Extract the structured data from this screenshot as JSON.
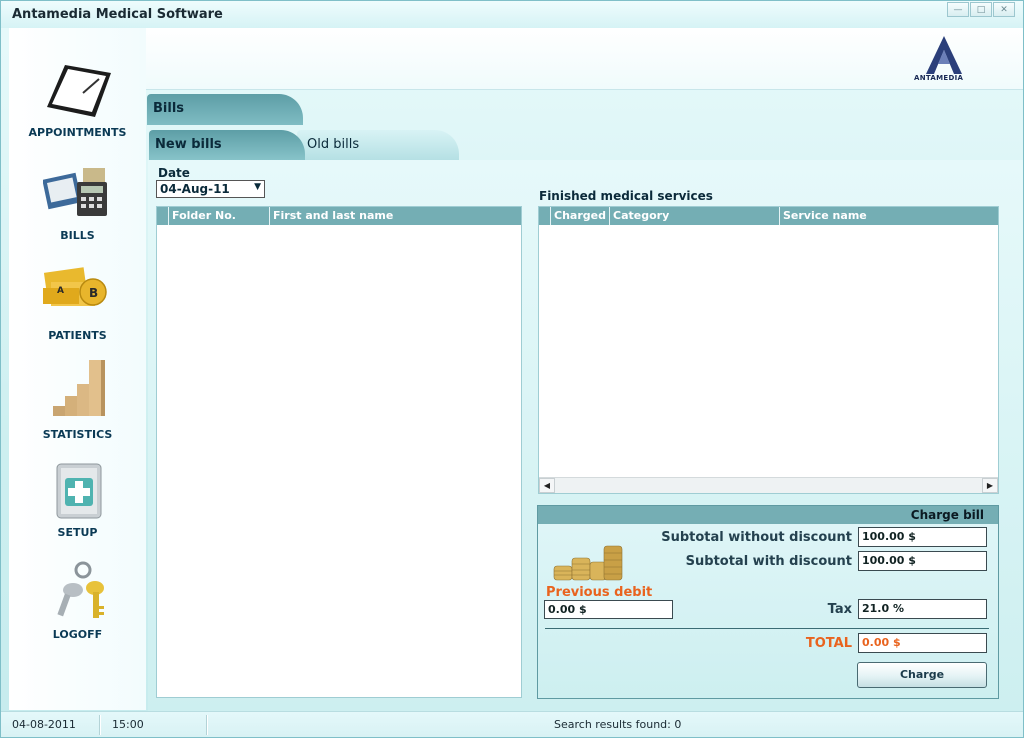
{
  "app": {
    "title": "Antamedia Medical Software",
    "logo_text": "ANTAMEDIA"
  },
  "window_controls": [
    "minimize",
    "maximize",
    "close"
  ],
  "sidebar": {
    "items": [
      {
        "label": "APPOINTMENTS",
        "icon": "clipboard-icon"
      },
      {
        "label": "BILLS",
        "icon": "calculator-icon"
      },
      {
        "label": "PATIENTS",
        "icon": "folders-icon"
      },
      {
        "label": "STATISTICS",
        "icon": "bar-chart-icon"
      },
      {
        "label": "SETUP",
        "icon": "medical-kit-icon"
      },
      {
        "label": "LOGOFF",
        "icon": "keys-icon"
      }
    ]
  },
  "tabs": {
    "main": "Bills",
    "new": "New bills",
    "old": "Old bills"
  },
  "date": {
    "label": "Date",
    "value": "04-Aug-11"
  },
  "patients_grid": {
    "columns": [
      "Folder No.",
      "First and last name"
    ]
  },
  "services": {
    "label": "Finished medical services",
    "columns": [
      "Charged",
      "Category",
      "Service name"
    ]
  },
  "charge": {
    "title": "Charge bill",
    "subtotal_no_discount_label": "Subtotal without discount",
    "subtotal_no_discount_value": "100.00 $",
    "subtotal_discount_label": "Subtotal with discount",
    "subtotal_discount_value": "100.00 $",
    "previous_debit_label": "Previous debit",
    "previous_debit_value": "0.00 $",
    "tax_label": "Tax",
    "tax_value": "21.0 %",
    "total_label": "TOTAL",
    "total_value": "0.00 $",
    "button": "Charge"
  },
  "status": {
    "date": "04-08-2011",
    "time": "15:00",
    "search_results": "Search results found: 0"
  },
  "colors": {
    "accent": "#74aeb4",
    "highlight": "#e9631e",
    "nav_text": "#0b3a55"
  }
}
